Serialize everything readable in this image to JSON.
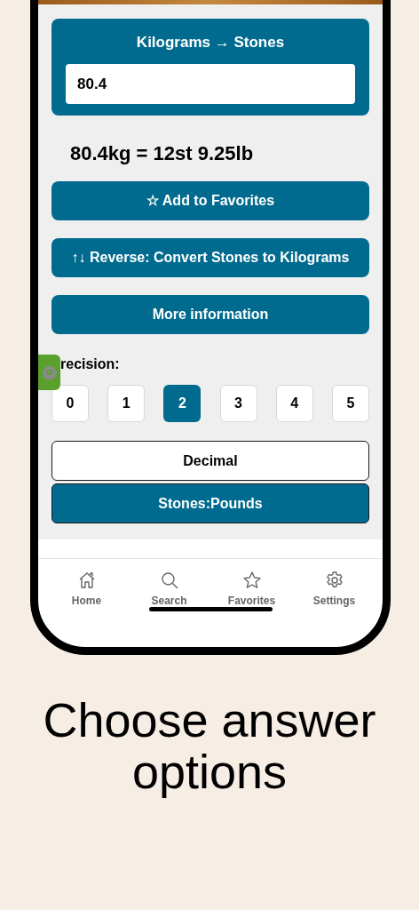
{
  "converter": {
    "title": "Kilograms → Stones",
    "value": "80.4"
  },
  "result": "80.4kg = 12st 9.25lb",
  "actions": [
    {
      "label": "☆ Add to Favorites"
    },
    {
      "label": "↑↓ Reverse: Convert Stones to Kilograms"
    },
    {
      "label": "More information"
    }
  ],
  "precision": {
    "label": "recision:",
    "options": [
      {
        "label": "0",
        "selected": false
      },
      {
        "label": "1",
        "selected": false
      },
      {
        "label": "2",
        "selected": true
      },
      {
        "label": "3",
        "selected": false
      },
      {
        "label": "4",
        "selected": false
      },
      {
        "label": "5",
        "selected": false
      }
    ]
  },
  "formats": [
    {
      "label": "Decimal",
      "selected": false
    },
    {
      "label": "Stones:Pounds",
      "selected": true
    }
  ],
  "tabs": [
    {
      "kind": "home",
      "label": "Home"
    },
    {
      "kind": "search",
      "label": "Search"
    },
    {
      "kind": "favorites",
      "label": "Favorites"
    },
    {
      "kind": "settings",
      "label": "Settings"
    }
  ],
  "headline": "Choose answer options"
}
